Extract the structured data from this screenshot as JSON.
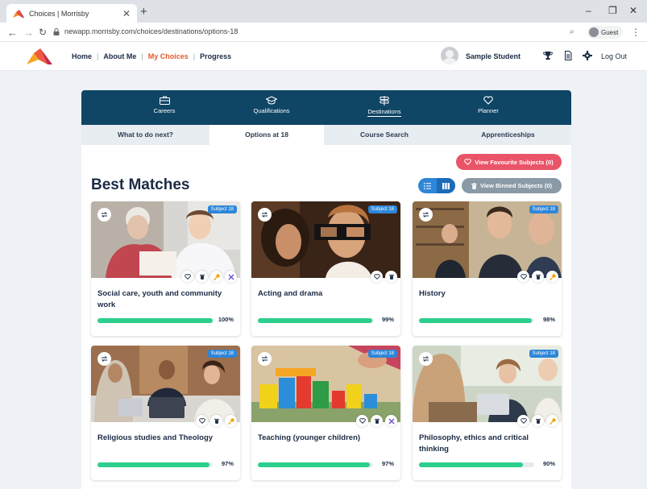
{
  "browser": {
    "tab_title": "Choices | Morrisby",
    "url": "newapp.morrisby.com/choices/destinations/options-18",
    "profile": "Guest"
  },
  "header": {
    "nav": [
      {
        "label": "Home",
        "active": false
      },
      {
        "label": "About Me",
        "active": false
      },
      {
        "label": "My Choices",
        "active": true
      },
      {
        "label": "Progress",
        "active": false
      }
    ],
    "user_name": "Sample Student",
    "logout": "Log Out"
  },
  "topnav": [
    {
      "label": "Careers",
      "icon": "briefcase-icon"
    },
    {
      "label": "Qualifications",
      "icon": "graduation-cap-icon"
    },
    {
      "label": "Destinations",
      "icon": "signpost-icon",
      "active": true
    },
    {
      "label": "Planner",
      "icon": "heart-icon"
    }
  ],
  "subnav": [
    {
      "label": "What to do next?"
    },
    {
      "label": "Options at 18",
      "active": true
    },
    {
      "label": "Course Search"
    },
    {
      "label": "Apprenticeships"
    }
  ],
  "actions": {
    "favourites": "View Favourite Subjects (0)",
    "binned": "View Binned Subjects (0)"
  },
  "section_title": "Best Matches",
  "cards": [
    {
      "title": "Social care, youth and community work",
      "badge": "Subject 18",
      "match": "100%",
      "fraction": 1.0,
      "icons": [
        "heart-icon",
        "bin-icon",
        "key-icon",
        "tools-icon"
      ]
    },
    {
      "title": "Acting and drama",
      "badge": "Subject 18",
      "match": "99%",
      "fraction": 0.99,
      "icons": [
        "heart-icon",
        "bin-icon"
      ]
    },
    {
      "title": "History",
      "badge": "Subject 18",
      "match": "98%",
      "fraction": 0.98,
      "icons": [
        "heart-icon",
        "bin-icon",
        "key-icon"
      ]
    },
    {
      "title": "Religious studies and Theology",
      "badge": "Subject 18",
      "match": "97%",
      "fraction": 0.97,
      "icons": [
        "heart-icon",
        "bin-icon",
        "key-icon"
      ]
    },
    {
      "title": "Teaching (younger children)",
      "badge": "Subject 18",
      "match": "97%",
      "fraction": 0.97,
      "icons": [
        "heart-icon",
        "bin-icon",
        "tools-icon"
      ]
    },
    {
      "title": "Philosophy, ethics and critical thinking",
      "badge": "Subject 18",
      "match": "90%",
      "fraction": 0.9,
      "icons": [
        "heart-icon",
        "bin-icon",
        "key-icon"
      ]
    }
  ],
  "colors": {
    "brand_navy": "#0f4565",
    "accent_orange": "#e65a2e",
    "favourite_pink": "#ea5468",
    "badge_blue": "#2e86d8",
    "progress_green": "#2ccf8c"
  }
}
